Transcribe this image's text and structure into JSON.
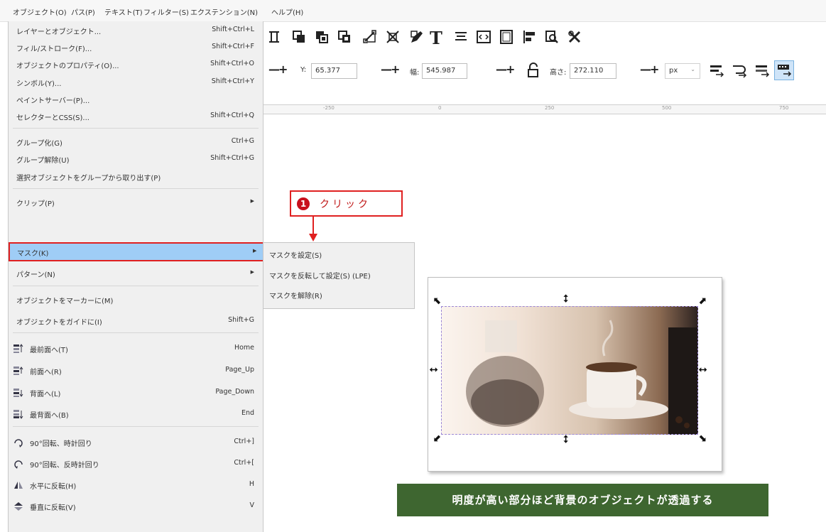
{
  "menubar": {
    "items": [
      "オブジェクト(O)",
      "パス(P)",
      "テキスト(T)",
      "フィルター(S)",
      "エクステンション(N)",
      "ヘルプ(H)"
    ]
  },
  "object_menu": {
    "items": [
      {
        "label": "レイヤーとオブジェクト...",
        "shortcut": "Shift+Ctrl+L"
      },
      {
        "label": "フィル/ストローク(F)...",
        "shortcut": "Shift+Ctrl+F"
      },
      {
        "label": "オブジェクトのプロパティ(O)...",
        "shortcut": "Shift+Ctrl+O"
      },
      {
        "label": "シンボル(Y)...",
        "shortcut": "Shift+Ctrl+Y"
      },
      {
        "label": "ペイントサーバー(P)...",
        "shortcut": ""
      },
      {
        "label": "セレクターとCSS(S)...",
        "shortcut": "Shift+Ctrl+Q"
      },
      {
        "label": "グループ化(G)",
        "shortcut": "Ctrl+G"
      },
      {
        "label": "グループ解除(U)",
        "shortcut": "Shift+Ctrl+G"
      },
      {
        "label": "選択オブジェクトをグループから取り出す(P)",
        "shortcut": ""
      },
      {
        "label": "クリップ(P)",
        "shortcut": ""
      },
      {
        "label": "マスク(K)",
        "shortcut": ""
      },
      {
        "label": "パターン(N)",
        "shortcut": ""
      },
      {
        "label": "オブジェクトをマーカーに(M)",
        "shortcut": ""
      },
      {
        "label": "オブジェクトをガイドに(I)",
        "shortcut": "Shift+G"
      },
      {
        "label": "最前面へ(T)",
        "shortcut": "Home"
      },
      {
        "label": "前面へ(R)",
        "shortcut": "Page_Up"
      },
      {
        "label": "背面へ(L)",
        "shortcut": "Page_Down"
      },
      {
        "label": "最背面へ(B)",
        "shortcut": "End"
      },
      {
        "label": "90°回転、時計回り",
        "shortcut": "Ctrl+]"
      },
      {
        "label": "90°回転、反時計回り",
        "shortcut": "Ctrl+["
      },
      {
        "label": "水平に反転(H)",
        "shortcut": "H"
      },
      {
        "label": "垂直に反転(V)",
        "shortcut": "V"
      }
    ]
  },
  "mask_submenu": {
    "items": [
      {
        "label": "マスクを設定(S)"
      },
      {
        "label": "マスクを反転して設定(S) (LPE)"
      },
      {
        "label": "マスクを解除(R)"
      }
    ]
  },
  "toolbar": {
    "y_label": "Y:",
    "y_value": "65.377",
    "w_label": "幅:",
    "w_value": "545.987",
    "h_label": "高さ:",
    "h_value": "272.110",
    "unit": "px"
  },
  "ruler": {
    "labels": [
      "-250",
      "0",
      "250",
      "500",
      "750"
    ]
  },
  "callout": {
    "number": "1",
    "text": "クリック"
  },
  "banner": {
    "text": "明度が高い部分ほど背景のオブジェクトが透過する"
  },
  "colors": {
    "highlight": "#9fcdf6",
    "highlight_border": "#e02020",
    "banner_bg": "#3e6630",
    "callout_num_bg": "#c8101c"
  }
}
